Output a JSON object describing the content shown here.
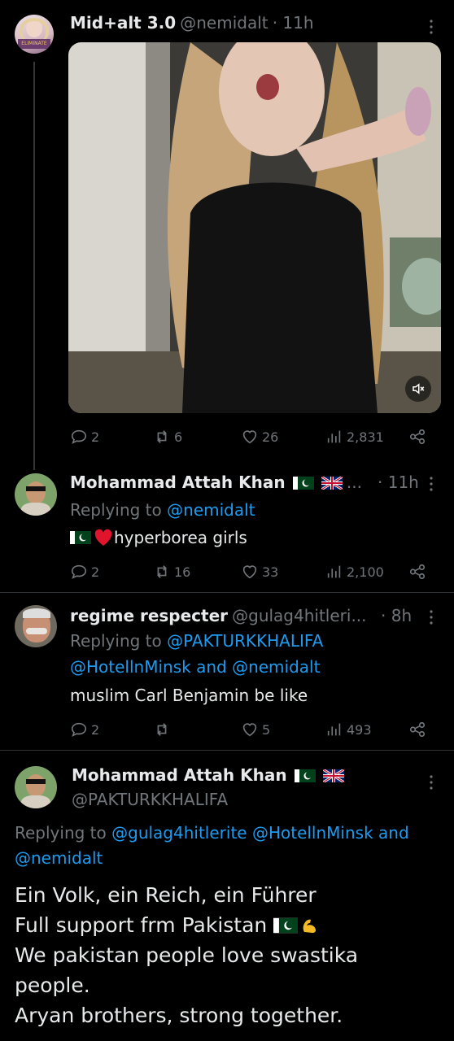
{
  "post1": {
    "name": "Mid+alt 3.0",
    "handle": "@nemidalt",
    "time": "· 11h",
    "avatar_label": "ELIMINATE",
    "metrics": {
      "replies": "2",
      "reposts": "6",
      "likes": "26",
      "views": "2,831"
    }
  },
  "post2": {
    "name": "Mohammad Attah Khan",
    "ellipsis": "...",
    "time": "· 11h",
    "replying_prefix": "Replying to",
    "replying_to": "@nemidalt",
    "text": "hyperborea girls",
    "metrics": {
      "replies": "2",
      "reposts": "16",
      "likes": "33",
      "views": "2,100"
    }
  },
  "post3": {
    "name": "regime respecter",
    "handle": "@gulag4hitleri...",
    "time": "· 8h",
    "replying_prefix": "Replying to",
    "replying_line1": "@PAKTURKKHALIFA",
    "replying_line2a": "@HotellnMinsk",
    "replying_and": "and",
    "replying_line2b": "@nemidalt",
    "text": "muslim Carl Benjamin be like",
    "metrics": {
      "replies": "2",
      "reposts": "",
      "likes": "5",
      "views": "493"
    }
  },
  "post4": {
    "name": "Mohammad Attah Khan",
    "handle": "@PAKTURKKHALIFA",
    "replying_prefix": "Replying to",
    "replying_a": "@gulag4hitlerite",
    "replying_b": "@HotellnMinsk",
    "replying_and": "and",
    "replying_c": "@nemidalt",
    "line1": "Ein Volk, ein Reich, ein Führer",
    "line2": "Full support frm Pakistan",
    "line3": "We pakistan people love swastika",
    "line4": "people.",
    "line5": "Aryan brothers, strong together."
  },
  "colors": {
    "accent": "#1d9bf0",
    "muted": "#71767b",
    "background": "#000000"
  }
}
